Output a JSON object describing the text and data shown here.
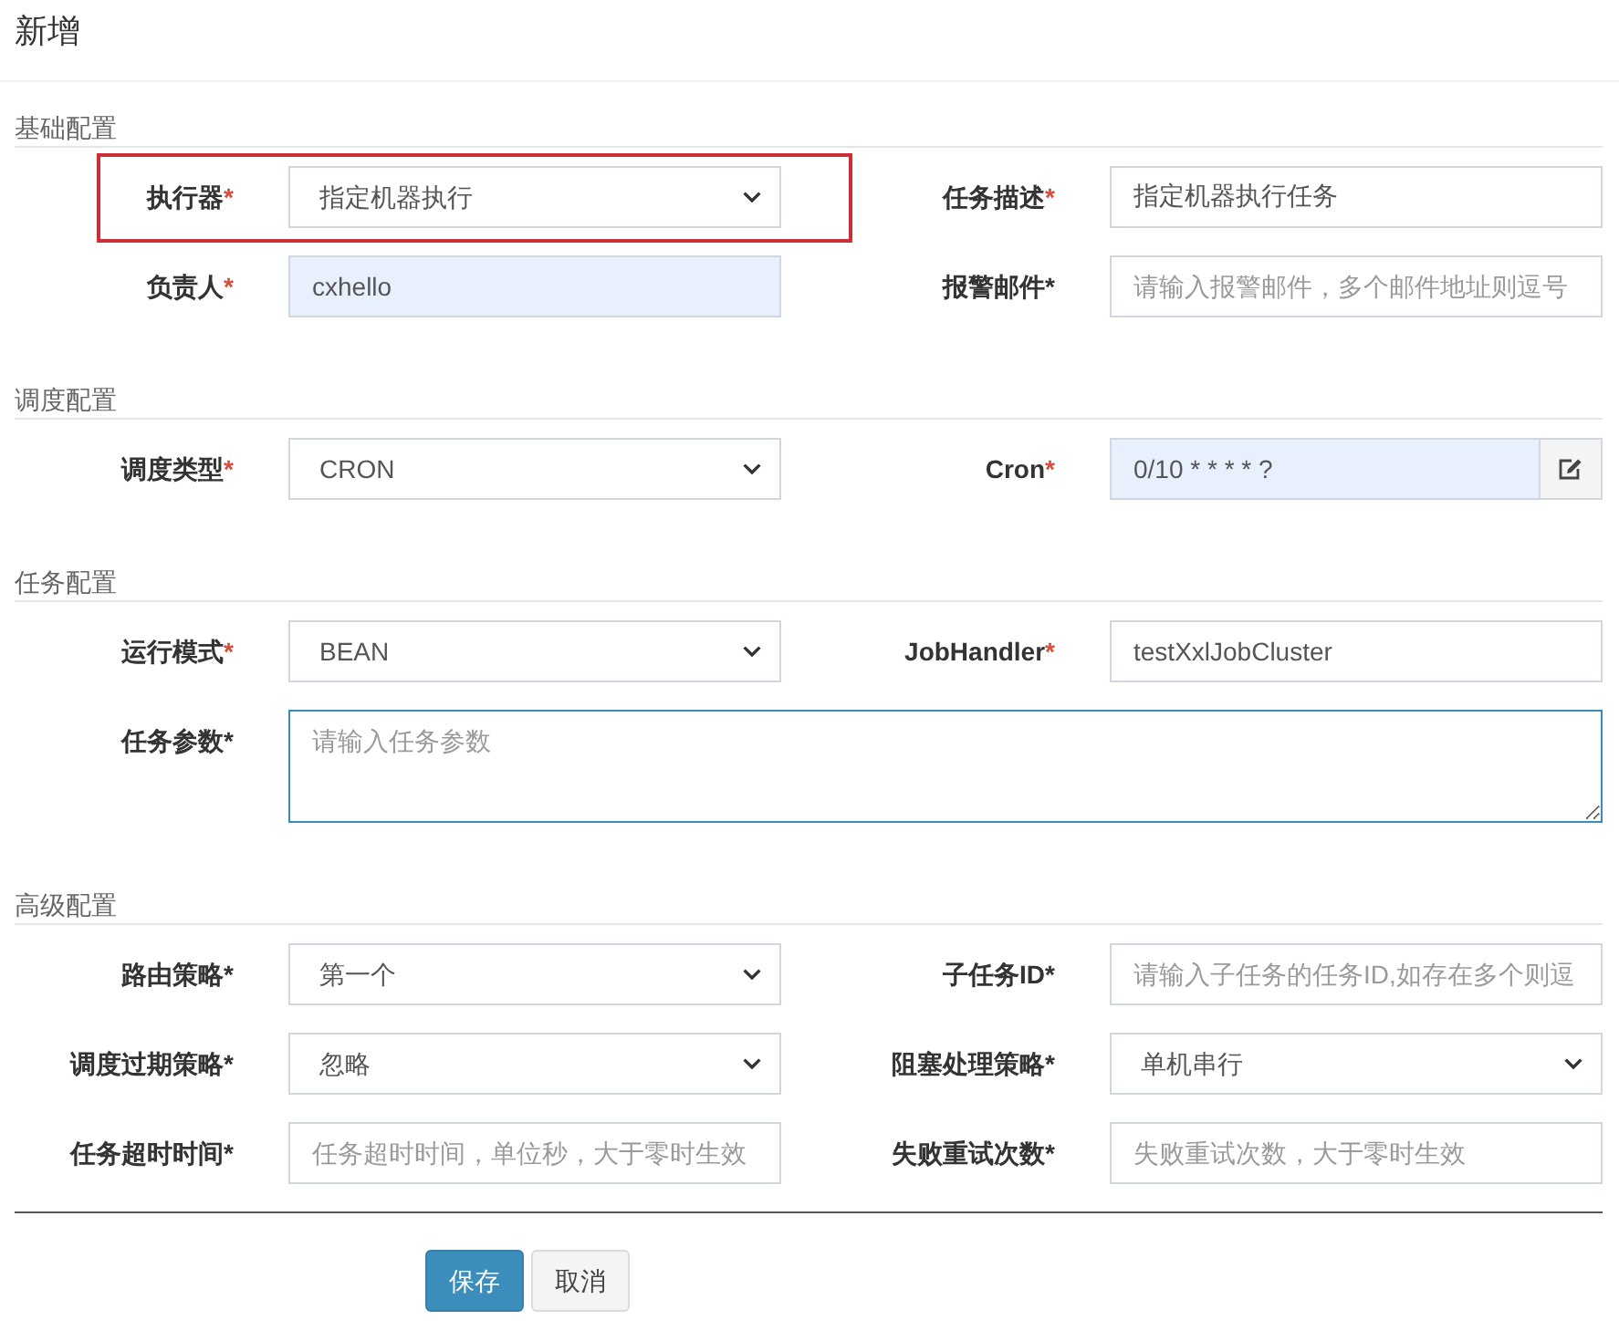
{
  "dialog": {
    "title": "新增"
  },
  "sections": [
    {
      "title": "基础配置",
      "rows": [
        {
          "fields": [
            {
              "label": "执行器",
              "mark": {
                "text": "*",
                "color": "#dd4b39"
              },
              "kind": "select",
              "value": "指定机器执行",
              "highlighted": true
            },
            {
              "label": "任务描述",
              "mark": {
                "text": "*",
                "color": "#dd4b39"
              },
              "kind": "text",
              "value": "指定机器执行任务",
              "autofilled": false,
              "highlighted": false
            }
          ]
        },
        {
          "fields": [
            {
              "label": "负责人",
              "mark": {
                "text": "*",
                "color": "#dd4b39"
              },
              "kind": "text",
              "value": "cxhello",
              "autofilled": true,
              "highlighted": false
            },
            {
              "label": "报警邮件",
              "mark": {
                "text": "*",
                "color": "#333333"
              },
              "kind": "text",
              "placeholder": "请输入报警邮件，多个邮件地址则逗号",
              "autofilled": false,
              "highlighted": false
            }
          ]
        }
      ]
    },
    {
      "title": "调度配置",
      "rows": [
        {
          "fields": [
            {
              "label": "调度类型",
              "mark": {
                "text": "*",
                "color": "#dd4b39"
              },
              "kind": "select",
              "value": "CRON",
              "highlighted": false
            },
            {
              "label": "Cron",
              "mark": {
                "text": "*",
                "color": "#dd4b39"
              },
              "kind": "input_group",
              "value": "0/10 * * * * ?",
              "autofilled": true,
              "highlighted": false
            }
          ]
        }
      ]
    },
    {
      "title": "任务配置",
      "rows": [
        {
          "fields": [
            {
              "label": "运行模式",
              "mark": {
                "text": "*",
                "color": "#dd4b39"
              },
              "kind": "select",
              "value": "BEAN",
              "highlighted": false
            },
            {
              "label": "JobHandler",
              "mark": {
                "text": "*",
                "color": "#dd4b39"
              },
              "kind": "text",
              "value": "testXxlJobCluster",
              "autofilled": false,
              "highlighted": false
            }
          ]
        },
        {
          "fields": [
            {
              "label": "任务参数",
              "mark": {
                "text": "*",
                "color": "#333333"
              },
              "kind": "textarea",
              "placeholder": "请输入任务参数",
              "focused": true,
              "highlighted": false
            }
          ]
        }
      ]
    },
    {
      "title": "高级配置",
      "rows": [
        {
          "fields": [
            {
              "label": "路由策略",
              "mark": {
                "text": "*",
                "color": "#333333"
              },
              "kind": "select",
              "value": "第一个",
              "highlighted": false
            },
            {
              "label": "子任务ID",
              "mark": {
                "text": "*",
                "color": "#333333"
              },
              "kind": "text",
              "placeholder": "请输入子任务的任务ID,如存在多个则逗",
              "autofilled": false,
              "highlighted": false
            }
          ]
        },
        {
          "fields": [
            {
              "label": "调度过期策略",
              "mark": {
                "text": "*",
                "color": "#333333"
              },
              "kind": "select",
              "value": "忽略",
              "highlighted": false
            },
            {
              "label": "阻塞处理策略",
              "mark": {
                "text": "*",
                "color": "#333333"
              },
              "kind": "select",
              "value": "单机串行",
              "highlighted": false
            }
          ]
        },
        {
          "fields": [
            {
              "label": "任务超时时间",
              "mark": {
                "text": "*",
                "color": "#333333"
              },
              "kind": "text",
              "placeholder": "任务超时时间，单位秒，大于零时生效",
              "autofilled": false,
              "highlighted": false
            },
            {
              "label": "失败重试次数",
              "mark": {
                "text": "*",
                "color": "#333333"
              },
              "kind": "text",
              "placeholder": "失败重试次数，大于零时生效",
              "autofilled": false,
              "highlighted": false
            }
          ]
        }
      ]
    }
  ],
  "buttons": [
    {
      "label": "保存",
      "kind": "primary"
    },
    {
      "label": "取消",
      "kind": "default"
    }
  ]
}
